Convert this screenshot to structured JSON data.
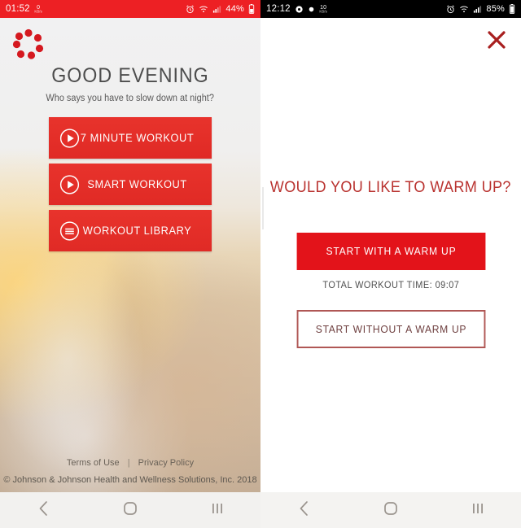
{
  "left_screen": {
    "status_bar": {
      "time": "01:52",
      "data_rate_value": "0",
      "data_rate_unit": "KB/s",
      "battery_percent": "44%",
      "icons": [
        "alarm-icon",
        "wifi-icon",
        "signal-icon",
        "battery-icon"
      ],
      "background_color": "#ed2024"
    },
    "logo_name": "johnson-johnson-dots-logo",
    "headline": "GOOD EVENING",
    "subline": "Who says you have to slow down at night?",
    "buttons": [
      {
        "label": "7 MINUTE WORKOUT",
        "icon": "play-circle-icon"
      },
      {
        "label": "SMART WORKOUT",
        "icon": "play-circle-icon"
      },
      {
        "label": "WORKOUT LIBRARY",
        "icon": "list-circle-icon"
      }
    ],
    "footer": {
      "terms_label": "Terms of Use",
      "separator": "|",
      "privacy_label": "Privacy Policy",
      "copyright": "© Johnson & Johnson Health and Wellness Solutions, Inc. 2018"
    }
  },
  "right_screen": {
    "status_bar": {
      "time": "12:12",
      "data_rate_value": "10",
      "data_rate_unit": "KB/s",
      "battery_percent": "85%",
      "icons": [
        "gear-icon",
        "dot-icon",
        "alarm-icon",
        "wifi-icon",
        "signal-icon",
        "battery-icon"
      ],
      "background_color": "#000000"
    },
    "close_icon": "close-x-icon",
    "title": "WOULD YOU LIKE TO WARM UP?",
    "primary_button": "START WITH A WARM UP",
    "total_time_label": "TOTAL WORKOUT TIME: 09:07",
    "secondary_button": "START WITHOUT A WARM UP"
  },
  "nav_bar": {
    "back_icon": "back-chevron-icon",
    "home_icon": "home-square-icon",
    "recents_icon": "recents-bars-icon"
  },
  "colors": {
    "brand_red": "#e3131a",
    "status_red": "#ed2024",
    "title_red": "#b9322f",
    "outline_red": "#b05755"
  }
}
